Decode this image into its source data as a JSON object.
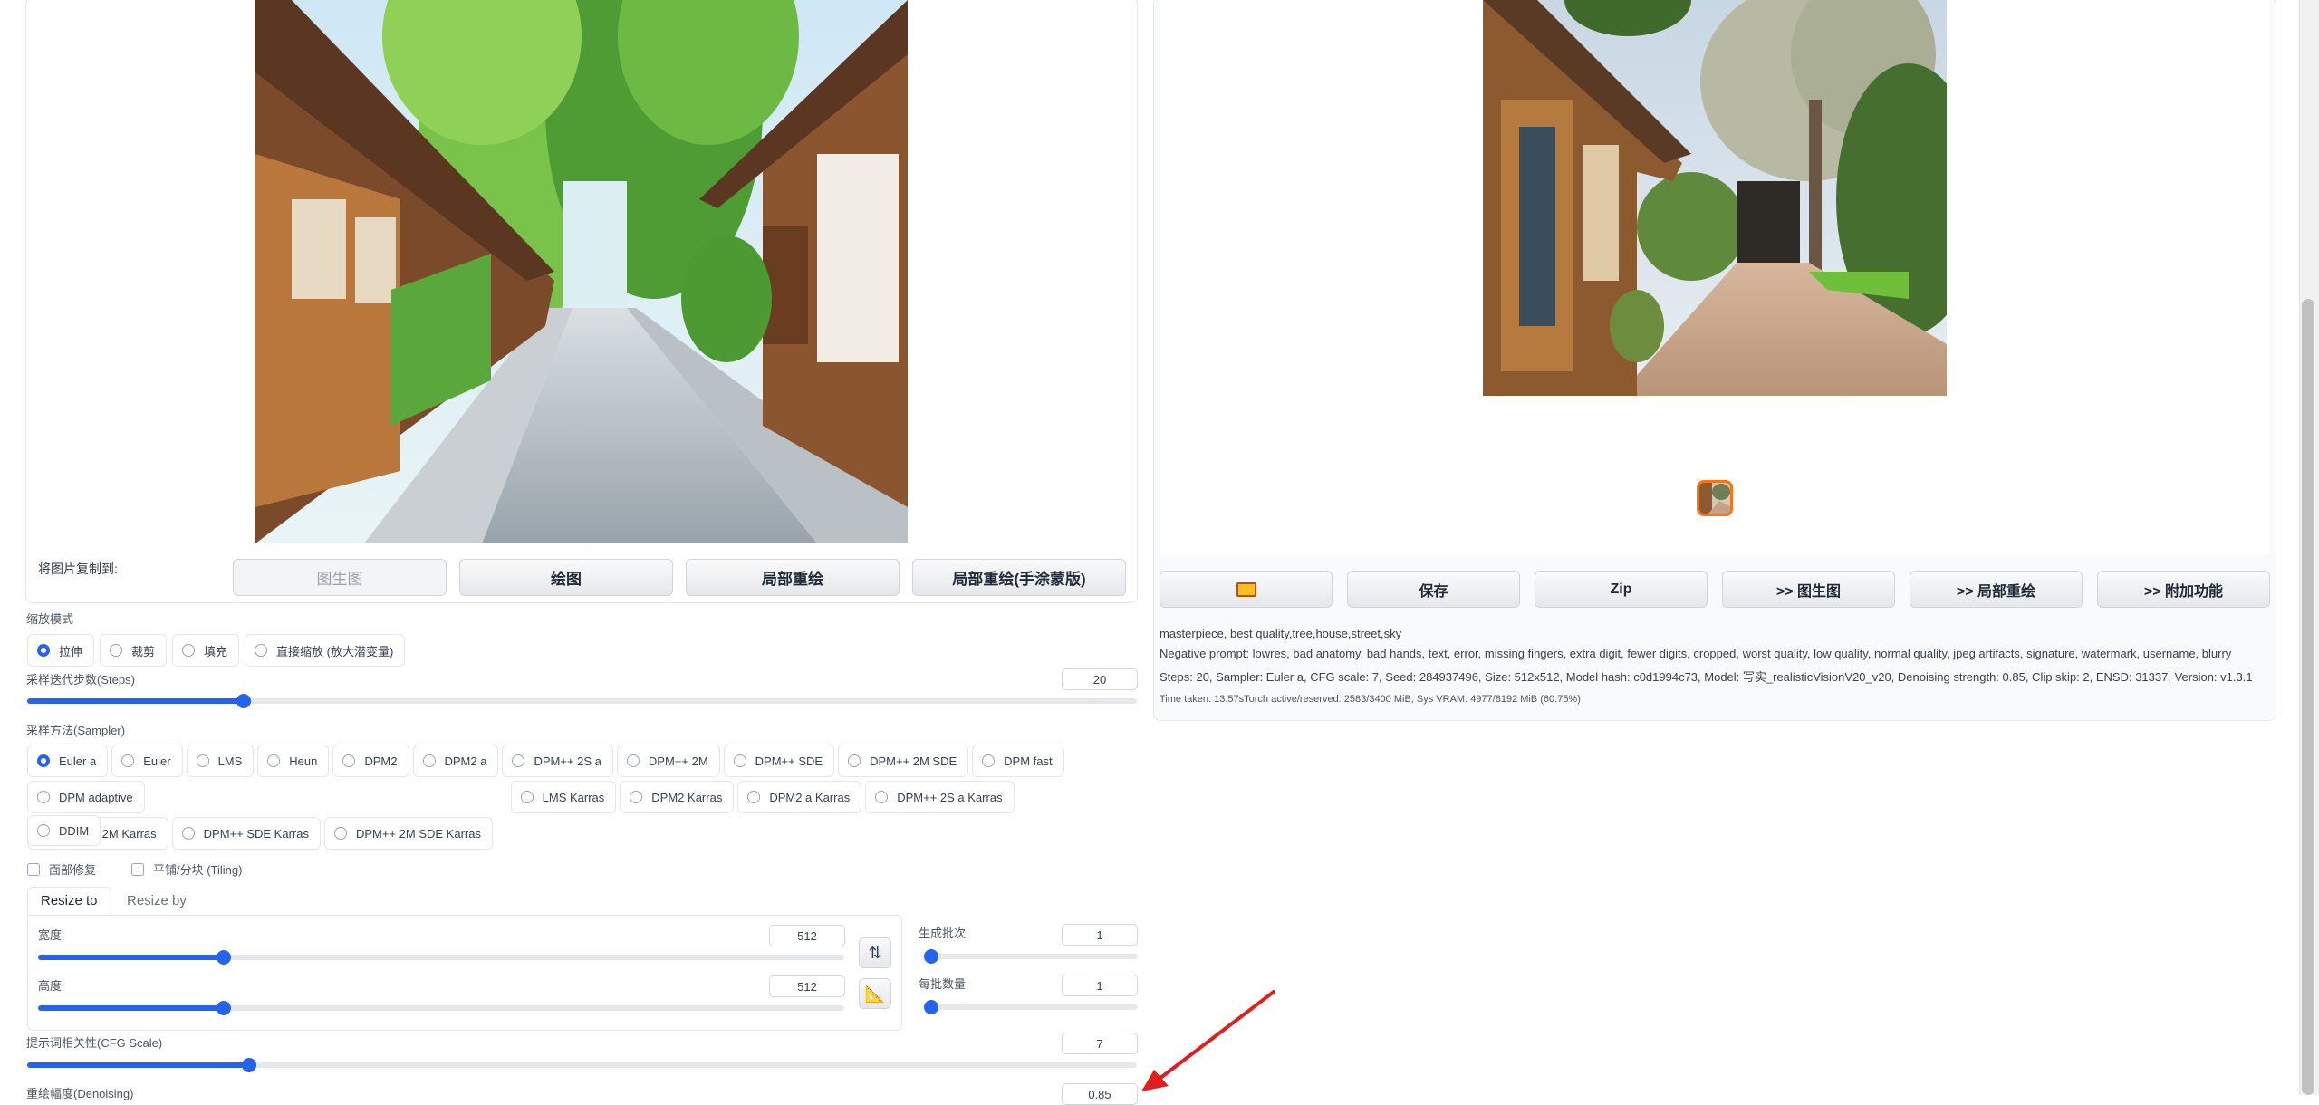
{
  "copy_to": {
    "label": "将图片复制到:",
    "buttons": [
      "图生图",
      "绘图",
      "局部重绘",
      "局部重绘(手涂蒙版)"
    ]
  },
  "resize_mode": {
    "label": "缩放模式",
    "options": [
      "拉伸",
      "裁剪",
      "填充",
      "直接缩放 (放大潜变量)"
    ],
    "selected": "拉伸"
  },
  "steps": {
    "label": "采样迭代步数(Steps)",
    "value": "20",
    "fraction": 0.195
  },
  "sampler": {
    "label": "采样方法(Sampler)",
    "options": [
      "Euler a",
      "Euler",
      "LMS",
      "Heun",
      "DPM2",
      "DPM2 a",
      "DPM++ 2S a",
      "DPM++ 2M",
      "DPM++ SDE",
      "DPM++ 2M SDE",
      "DPM fast",
      "DPM adaptive",
      "LMS Karras",
      "DPM2 Karras",
      "DPM2 a Karras",
      "DPM++ 2S a Karras",
      "DPM++ 2M Karras",
      "DPM++ SDE Karras",
      "DPM++ 2M SDE Karras",
      "DDIM"
    ],
    "selected": "Euler a"
  },
  "checks": {
    "face_restore": "面部修复",
    "tiling": "平铺/分块 (Tiling)"
  },
  "tabs": {
    "resize_to": "Resize to",
    "resize_by": "Resize by"
  },
  "width": {
    "label": "宽度",
    "value": "512",
    "fraction": 0.23
  },
  "height": {
    "label": "高度",
    "value": "512",
    "fraction": 0.23
  },
  "batch_count": {
    "label": "生成批次",
    "value": "1",
    "fraction": 0.0
  },
  "batch_size": {
    "label": "每批数量",
    "value": "1",
    "fraction": 0.0
  },
  "cfg": {
    "label": "提示词相关性(CFG Scale)",
    "value": "7",
    "fraction": 0.2
  },
  "denoising": {
    "label": "重绘幅度(Denoising)",
    "value": "0.85"
  },
  "output_actions": {
    "folder_icon": "folder-icon",
    "buttons": [
      "保存",
      "Zip",
      ">> 图生图",
      ">> 局部重绘",
      ">> 附加功能"
    ]
  },
  "generation_info": {
    "prompt": "masterpiece, best quality,tree,house,street,sky",
    "negative": "Negative prompt: lowres, bad anatomy, bad hands, text, error, missing fingers, extra digit, fewer digits, cropped, worst quality, low quality, normal quality, jpeg artifacts, signature, watermark, username, blurry",
    "params": "Steps: 20, Sampler: Euler a, CFG scale: 7, Seed: 284937496, Size: 512x512, Model hash: c0d1994c73, Model: 写实_realisticVisionV20_v20, Denoising strength: 0.85, Clip skip: 2, ENSD: 31337, Version: v1.3.1",
    "timing": "Time taken: 13.57sTorch active/reserved: 2583/3400 MiB, Sys VRAM: 4977/8192 MiB (60.75%)"
  },
  "colors": {
    "accent": "#2563eb",
    "annotation_arrow": "#e11d1d",
    "thumb_border": "#f97316"
  },
  "icons": {
    "swap": "swap-icon",
    "ruler": "ruler-triangle-icon",
    "arrow": "red-arrow-icon"
  }
}
